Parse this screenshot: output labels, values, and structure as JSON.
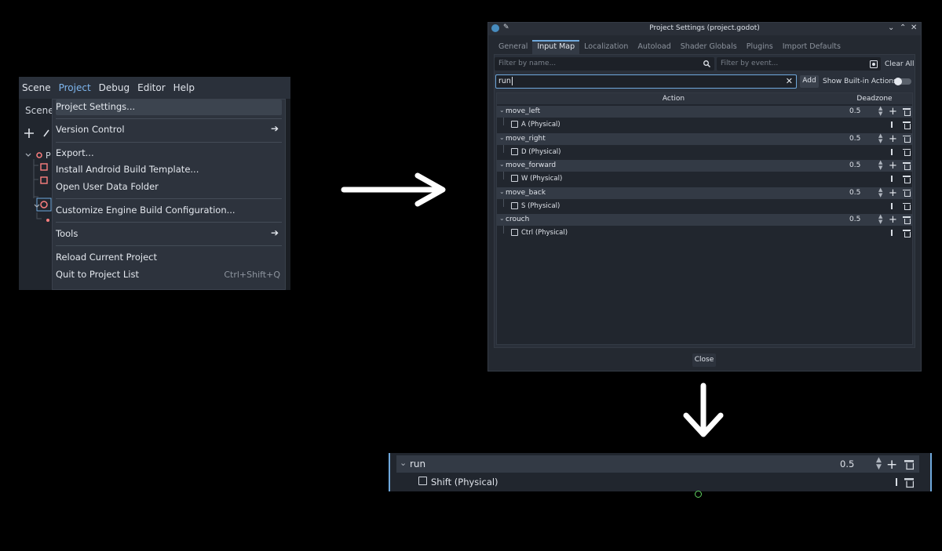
{
  "editor": {
    "menubar": [
      "Scene",
      "Project",
      "Debug",
      "Editor",
      "Help"
    ],
    "dock_tab": "Scene",
    "tree_root_initial": "P",
    "menu": {
      "items": [
        {
          "label": "Project Settings...",
          "hover": true
        },
        {
          "label": "Version Control",
          "submenu": true
        },
        {
          "label": "Export..."
        },
        {
          "label": "Install Android Build Template..."
        },
        {
          "label": "Open User Data Folder"
        },
        {
          "label": "Customize Engine Build Configuration..."
        },
        {
          "label": "Tools",
          "submenu": true
        },
        {
          "label": "Reload Current Project"
        },
        {
          "label": "Quit to Project List",
          "shortcut": "Ctrl+Shift+Q"
        }
      ]
    }
  },
  "settings": {
    "window_title": "Project Settings (project.godot)",
    "tabs": [
      "General",
      "Input Map",
      "Localization",
      "Autoload",
      "Shader Globals",
      "Plugins",
      "Import Defaults"
    ],
    "active_tab": "Input Map",
    "filter_name_placeholder": "Filter by name...",
    "filter_event_placeholder": "Filter by event...",
    "clear_all": "Clear All",
    "new_action_value": "run",
    "add_label": "Add",
    "show_builtin_label": "Show Built-in Actions",
    "col_action": "Action",
    "col_deadzone": "Deadzone",
    "actions": [
      {
        "name": "move_left",
        "deadzone": "0.5",
        "event": "A (Physical)"
      },
      {
        "name": "move_right",
        "deadzone": "0.5",
        "event": "D (Physical)"
      },
      {
        "name": "move_forward",
        "deadzone": "0.5",
        "event": "W (Physical)"
      },
      {
        "name": "move_back",
        "deadzone": "0.5",
        "event": "S (Physical)"
      },
      {
        "name": "crouch",
        "deadzone": "0.5",
        "event": "Ctrl (Physical)"
      }
    ],
    "close_label": "Close"
  },
  "zoomed": {
    "name": "run",
    "deadzone": "0.5",
    "event": "Shift (Physical)"
  },
  "colors": {
    "accent": "#6fa8dc",
    "menu_active": "#7eb6ee",
    "godot_icon": "#478cbf",
    "node_icon": "#fc7f7f"
  }
}
